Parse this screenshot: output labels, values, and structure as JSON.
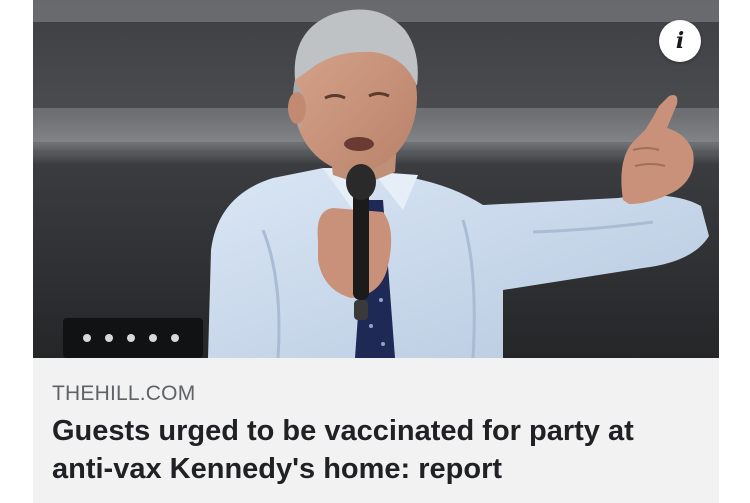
{
  "card": {
    "source": "THEHILL.COM",
    "headline": "Guests urged to be vaccinated for party at anti-vax Kennedy's home: report",
    "info_icon": "i"
  },
  "photo": {
    "subject": "man-speaking-into-microphone-pointing"
  },
  "colors": {
    "card_background": "#f2f2f2",
    "source_text": "#5f6368",
    "headline_text": "#202124"
  },
  "icons": {
    "info": "info-icon"
  }
}
